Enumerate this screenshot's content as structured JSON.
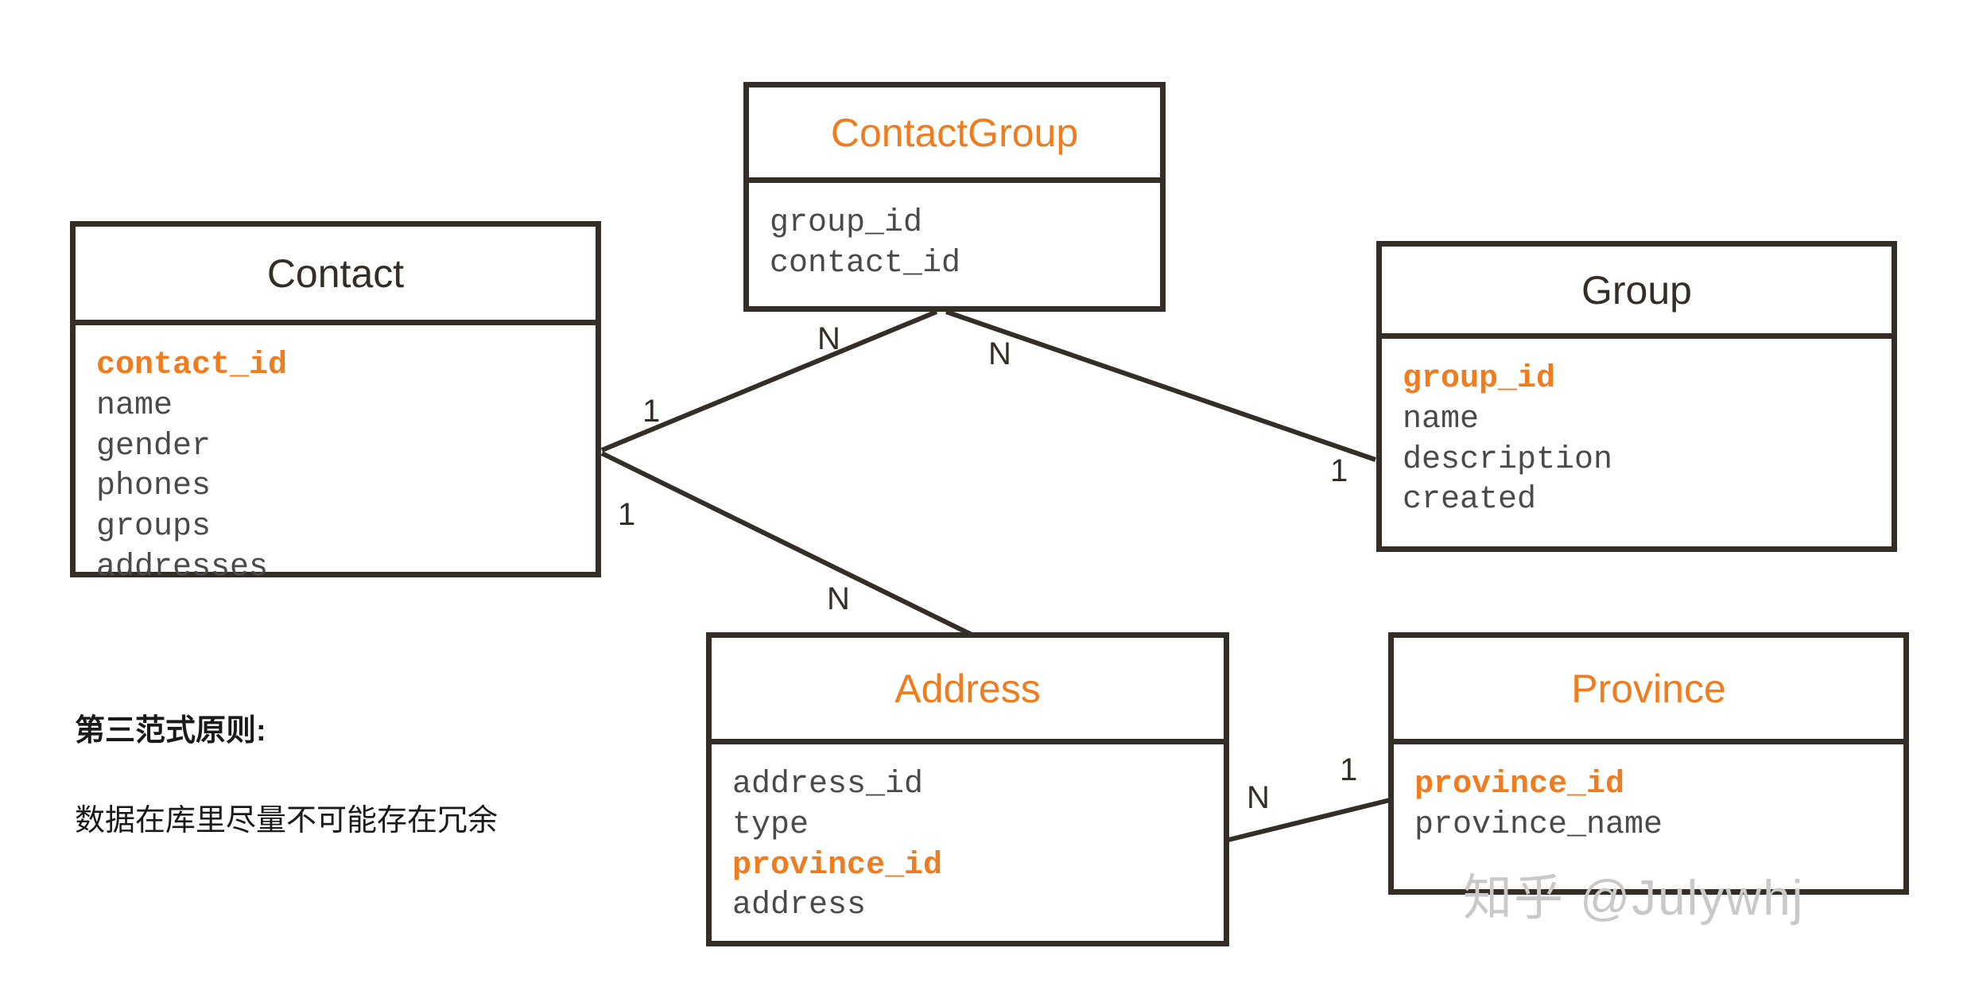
{
  "diagram": {
    "kind": "er-diagram",
    "colors": {
      "accent": "#f07c20",
      "line": "#342e26",
      "field_text": "#4a4a4a",
      "watermark": "#c9c9c9",
      "background": "#ffffff"
    }
  },
  "entities": {
    "contact": {
      "title": "Contact",
      "title_color": "dark",
      "fields": [
        {
          "name": "contact_id",
          "key": true
        },
        {
          "name": "name",
          "key": false
        },
        {
          "name": "gender",
          "key": false
        },
        {
          "name": "phones",
          "key": false
        },
        {
          "name": "groups",
          "key": false
        },
        {
          "name": "addresses",
          "key": false
        }
      ]
    },
    "contact_group": {
      "title": "ContactGroup",
      "title_color": "accent",
      "fields": [
        {
          "name": "group_id",
          "key": false
        },
        {
          "name": "contact_id",
          "key": false
        }
      ]
    },
    "group": {
      "title": "Group",
      "title_color": "dark",
      "fields": [
        {
          "name": "group_id",
          "key": true
        },
        {
          "name": "name",
          "key": false
        },
        {
          "name": "description",
          "key": false
        },
        {
          "name": "created",
          "key": false
        }
      ]
    },
    "address": {
      "title": "Address",
      "title_color": "accent",
      "fields": [
        {
          "name": "address_id",
          "key": false
        },
        {
          "name": "type",
          "key": false
        },
        {
          "name": "province_id",
          "key": true
        },
        {
          "name": "address",
          "key": false
        }
      ]
    },
    "province": {
      "title": "Province",
      "title_color": "accent",
      "fields": [
        {
          "name": "province_id",
          "key": true
        },
        {
          "name": "province_name",
          "key": false
        }
      ]
    }
  },
  "relations": [
    {
      "id": "contact-contactgroup",
      "from": "contact",
      "to": "contact_group",
      "from_cardinality": "1",
      "to_cardinality": "N"
    },
    {
      "id": "contactgroup-group",
      "from": "contact_group",
      "to": "group",
      "from_cardinality": "N",
      "to_cardinality": "1"
    },
    {
      "id": "contact-address",
      "from": "contact",
      "to": "address",
      "from_cardinality": "1",
      "to_cardinality": "N"
    },
    {
      "id": "address-province",
      "from": "address",
      "to": "province",
      "from_cardinality": "N",
      "to_cardinality": "1"
    }
  ],
  "cardinality_labels": {
    "contact_to_cg": "1",
    "cg_from_contact": "N",
    "cg_to_group": "N",
    "group_from_cg": "1",
    "contact_to_address": "1",
    "address_from_contact": "N",
    "address_to_province": "N",
    "province_from_address": "1"
  },
  "note": {
    "title": "第三范式原则:",
    "body": "数据在库里尽量不可能存在冗余"
  },
  "watermark": {
    "text": "知乎 @Julywhj"
  }
}
